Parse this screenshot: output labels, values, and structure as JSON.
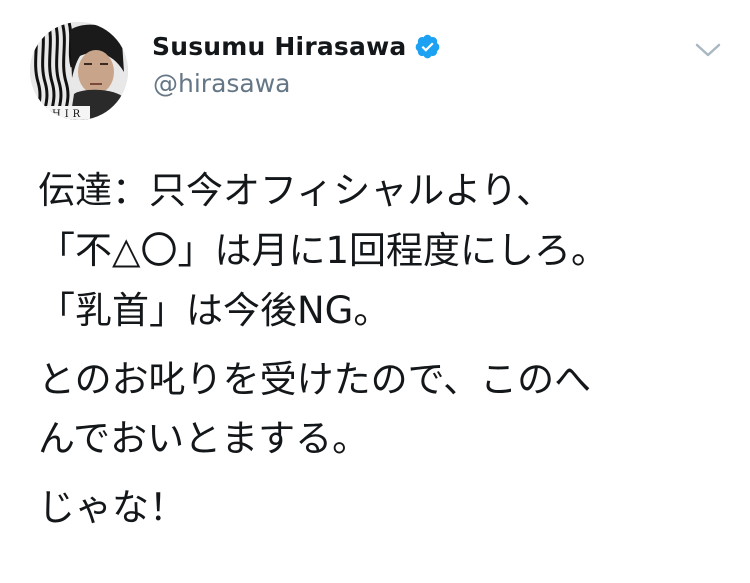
{
  "author": {
    "display_name": "Susumu Hirasawa",
    "handle": "@hirasawa",
    "verified": true,
    "avatar_text": "HIR"
  },
  "header": {
    "menu_icon": "chevron-down-icon"
  },
  "tweet": {
    "lines": [
      "伝達：只今オフィシャルより、",
      "「不△〇」は月に1回程度にしろ。",
      "「乳首」は今後NG。",
      "とのお叱りを受けたので、このへ",
      "んでおいとまする。",
      "じゃな！"
    ]
  },
  "colors": {
    "text": "#14171a",
    "secondary": "#657786",
    "verified_badge": "#1da1f2",
    "chevron": "#aab8c2"
  }
}
